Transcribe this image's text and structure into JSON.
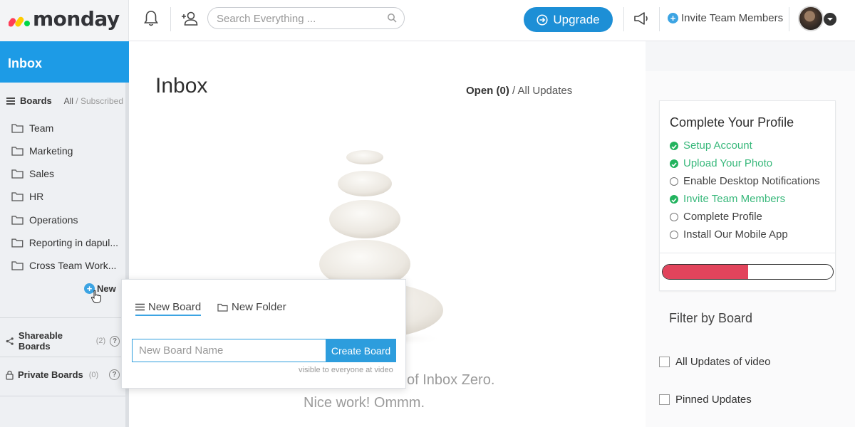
{
  "topbar": {
    "logo_text": "monday",
    "search": {
      "placeholder": "Search Everything ..."
    },
    "upgrade_label": "Upgrade",
    "invite_label": "Invite Team Members",
    "icons": [
      "bell-icon",
      "user-add-icon",
      "search-icon",
      "megaphone-icon",
      "plus-circle-icon",
      "chevron-down-icon"
    ],
    "colors": {
      "upgrade": "#1d8fd6",
      "logo_red": "#ff3d57",
      "logo_yellow": "#ffcb00",
      "logo_green": "#00d647"
    }
  },
  "sidebar": {
    "inbox_label": "Inbox",
    "boards_label": "Boards",
    "filter_all": "All",
    "filter_sep": " / ",
    "filter_subscribed": "Subscribed",
    "boards": [
      {
        "label": "Team"
      },
      {
        "label": "Marketing"
      },
      {
        "label": "Sales"
      },
      {
        "label": "HR"
      },
      {
        "label": "Operations"
      },
      {
        "label": "Reporting in dapul..."
      },
      {
        "label": "Cross Team Work..."
      }
    ],
    "new_label": "New",
    "shareable": {
      "label": "Shareable Boards",
      "count": "(2)"
    },
    "private": {
      "label": "Private Boards",
      "count": "(0)"
    },
    "help_glyph": "?",
    "accent": "#1d9be6"
  },
  "main": {
    "title": "Inbox",
    "filter_open": "Open (0)",
    "filter_sep": " / ",
    "filter_all": "All Updates",
    "zero_text": "of Inbox Zero.",
    "nice_text": "Nice work! Ommm."
  },
  "popover": {
    "tab_new_board": "New Board",
    "tab_new_folder": "New Folder",
    "name_placeholder": "New Board Name",
    "create_label": "Create Board",
    "visibility_note": "visible to everyone at video"
  },
  "profile": {
    "title": "Complete Your Profile",
    "tasks": [
      {
        "label": "Setup Account",
        "done": true
      },
      {
        "label": "Upload Your Photo",
        "done": true
      },
      {
        "label": "Enable Desktop Notifications",
        "done": false
      },
      {
        "label": "Invite Team Members",
        "done": true
      },
      {
        "label": "Complete Profile",
        "done": false
      },
      {
        "label": "Install Our Mobile App",
        "done": false
      }
    ],
    "progress_fraction": 0.5,
    "colors": {
      "done": "#38b87b",
      "progress": "#e2445c"
    }
  },
  "filter_by_board": {
    "title": "Filter by Board",
    "options": [
      {
        "label": "All Updates of video"
      },
      {
        "label": "Pinned Updates"
      }
    ]
  }
}
